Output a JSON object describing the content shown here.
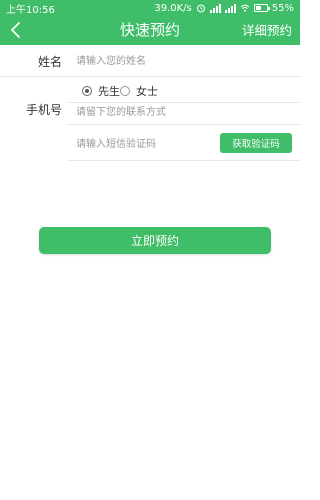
{
  "status_bar": {
    "time": "上午10:56",
    "net_speed": "39.0K/s",
    "battery": "55%",
    "icons": [
      "alarm-icon",
      "signal-icon",
      "wifi-icon",
      "battery-icon"
    ],
    "battery_level_percent": 55
  },
  "nav": {
    "title": "快速预约",
    "right_link": "详细预约",
    "back_icon": "chevron-left-icon",
    "bg_color": "#3fbd68"
  },
  "form": {
    "name_label": "姓名",
    "name_placeholder": "请输入您的姓名",
    "name_value": "",
    "gender_options": [
      "先生",
      "女士"
    ],
    "gender_selected": "先生",
    "phone_label": "手机号",
    "phone_placeholder": "请留下您的联系方式",
    "phone_value": "",
    "code_placeholder": "请输入短信验证码",
    "code_value": "",
    "code_button": "获取验证码"
  },
  "submit_label": "立即预约"
}
